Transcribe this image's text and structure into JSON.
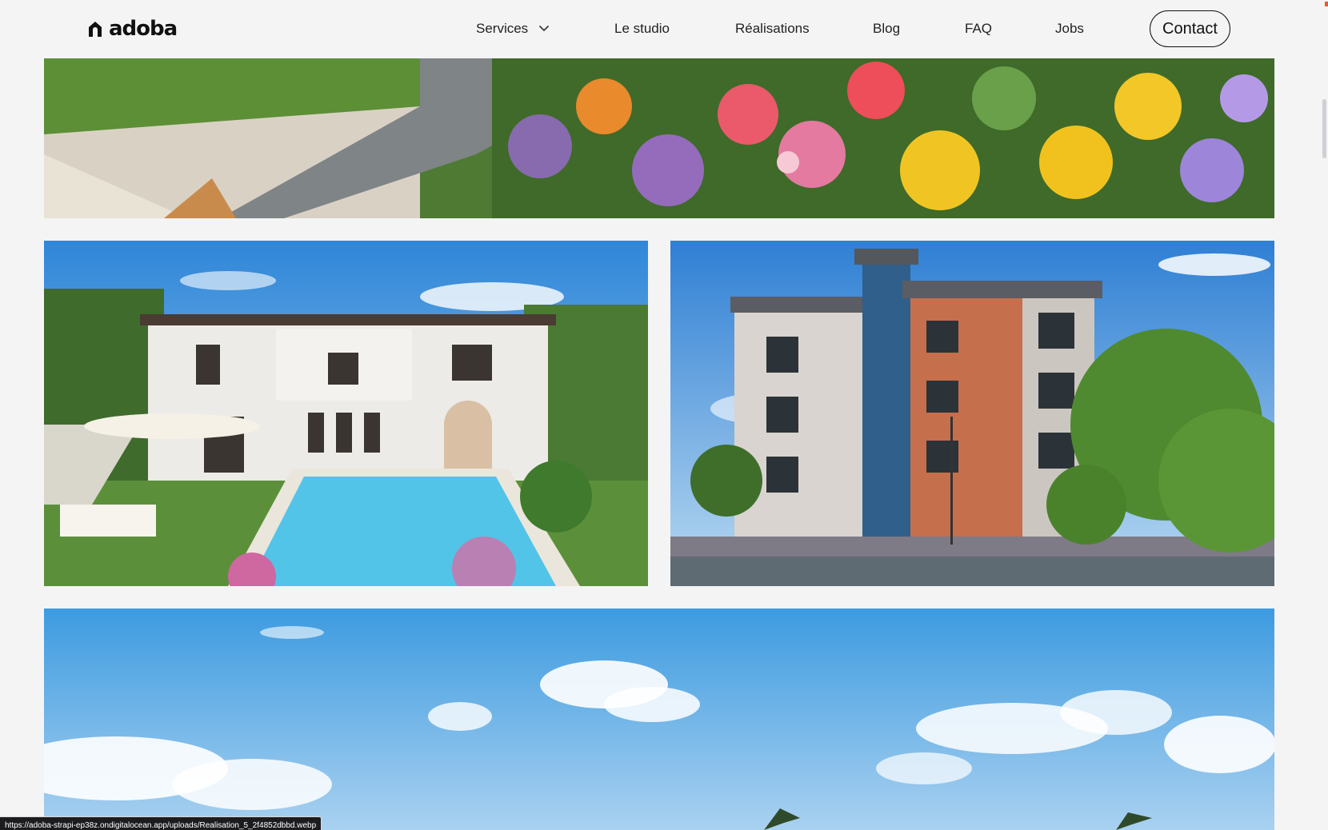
{
  "brand": {
    "name": "adoba"
  },
  "nav": {
    "items": [
      {
        "label": "Services",
        "has_dropdown": true
      },
      {
        "label": "Le studio"
      },
      {
        "label": "Réalisations"
      },
      {
        "label": "Blog"
      },
      {
        "label": "FAQ"
      },
      {
        "label": "Jobs"
      }
    ],
    "contact_label": "Contact"
  },
  "gallery": {
    "images": [
      {
        "name": "garden-flowers-render",
        "subject": "garden path with colorful flower beds"
      },
      {
        "name": "villa-pool-render",
        "subject": "white mediterranean villa with swimming pool"
      },
      {
        "name": "apartment-building-render",
        "subject": "brick and grey apartment building with trees"
      },
      {
        "name": "sky-palms-render",
        "subject": "blue sky with clouds and palm tree tops"
      }
    ]
  },
  "status_bar": {
    "url": "https://adoba-strapi-ep38z.ondigitalocean.app/uploads/Realisation_5_2f4852dbbd.webp"
  },
  "colors": {
    "background": "#f4f4f5",
    "text": "#1d1d1f",
    "sky": "#3f9fe0"
  }
}
